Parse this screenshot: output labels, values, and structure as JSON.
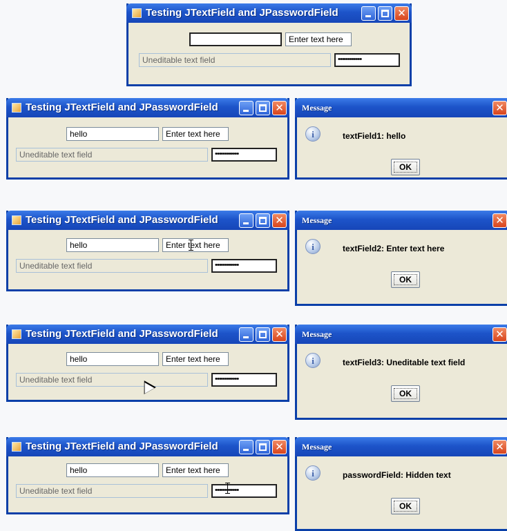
{
  "window": {
    "title": "Testing JTextField and JPasswordField"
  },
  "fields": {
    "text_field_1_placeholder_state": "",
    "text_field_1_value": "hello",
    "text_field_2_value": "Enter text here",
    "text_field_3_value": "Uneditable text field",
    "password_field_mask": "••••••••••••"
  },
  "dialog": {
    "title": "Message",
    "ok_label": "OK",
    "info_glyph": "i",
    "messages": [
      "textField1: hello",
      "textField2: Enter text here",
      "textField3: Uneditable text field",
      "passwordField: Hidden text"
    ]
  },
  "icons": {
    "app": "java-app-icon",
    "minimize": "minimize-icon",
    "maximize": "maximize-icon",
    "close": "close-icon",
    "info": "info-icon",
    "close_glyph": "✕"
  },
  "colors": {
    "titlebar": "#1d54c9",
    "window_border": "#0a3fa8",
    "window_bg": "#ece9d8",
    "close_button": "#d8441c",
    "page_bg": "#f7f8fa"
  }
}
